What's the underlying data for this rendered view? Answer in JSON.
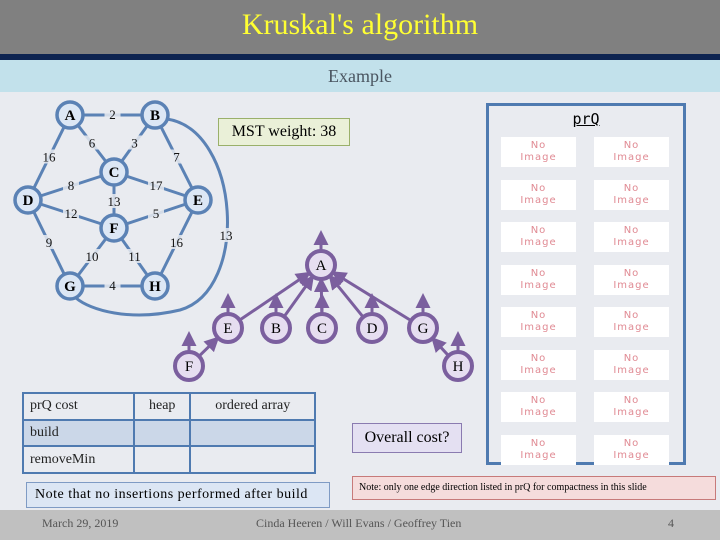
{
  "slide": {
    "title": "Kruskal's algorithm",
    "subtitle": "Example",
    "title_color": "#ffff33"
  },
  "graph": {
    "nodes": [
      "A",
      "B",
      "C",
      "D",
      "E",
      "F",
      "G",
      "H"
    ],
    "edges": [
      {
        "u": "A",
        "v": "B",
        "w": "2"
      },
      {
        "u": "A",
        "v": "C",
        "w": "6"
      },
      {
        "u": "B",
        "v": "C",
        "w": "3"
      },
      {
        "u": "A",
        "v": "D",
        "w": "16"
      },
      {
        "u": "B",
        "v": "E",
        "w": "7"
      },
      {
        "u": "C",
        "v": "D",
        "w": "8"
      },
      {
        "u": "C",
        "v": "E",
        "w": "17"
      },
      {
        "u": "C",
        "v": "F",
        "w": "13"
      },
      {
        "u": "D",
        "v": "F",
        "w": "12"
      },
      {
        "u": "F",
        "v": "E",
        "w": "5"
      },
      {
        "u": "D",
        "v": "G",
        "w": "9"
      },
      {
        "u": "F",
        "v": "G",
        "w": "10"
      },
      {
        "u": "F",
        "v": "H",
        "w": "11"
      },
      {
        "u": "E",
        "v": "H",
        "w": "16"
      },
      {
        "u": "G",
        "v": "H",
        "w": "4"
      },
      {
        "u": "B",
        "v": "G",
        "w": "13"
      }
    ],
    "edge_color": "#5b82b5",
    "node_fill": "#dce7f5"
  },
  "mst": {
    "label": "MST weight: 38"
  },
  "union_find": {
    "nodes": [
      "A",
      "E",
      "B",
      "C",
      "D",
      "G",
      "F",
      "H"
    ],
    "parent_links": [
      {
        "child": "E",
        "parent": "A"
      },
      {
        "child": "B",
        "parent": "A"
      },
      {
        "child": "C",
        "parent": "A"
      },
      {
        "child": "D",
        "parent": "A"
      },
      {
        "child": "G",
        "parent": "A"
      },
      {
        "child": "F",
        "parent": "E"
      },
      {
        "child": "H",
        "parent": "G"
      }
    ],
    "color": "#7b5f9e",
    "node_fill": "#e6def0"
  },
  "prq": {
    "title": "prQ",
    "items": [
      [
        "No Image",
        "No Image"
      ],
      [
        "No Image",
        "No Image"
      ],
      [
        "No Image",
        "No Image"
      ],
      [
        "No Image",
        "No Image"
      ],
      [
        "No Image",
        "No Image"
      ],
      [
        "No Image",
        "No Image"
      ],
      [
        "No Image",
        "No Image"
      ],
      [
        "No Image",
        "No Image"
      ]
    ]
  },
  "cost_table": {
    "headers": [
      "prQ cost",
      "heap",
      "ordered array"
    ],
    "rows": [
      [
        "build",
        "",
        ""
      ],
      [
        "removeMin",
        "",
        ""
      ]
    ]
  },
  "overall_cost": "Overall cost?",
  "notes": {
    "insertions": "Note that no insertions performed after build",
    "direction": "Note: only one edge direction listed in prQ for compactness in this slide"
  },
  "footer": {
    "date": "March 29, 2019",
    "authors": "Cinda Heeren / Will Evans / Geoffrey Tien",
    "page": "4"
  }
}
